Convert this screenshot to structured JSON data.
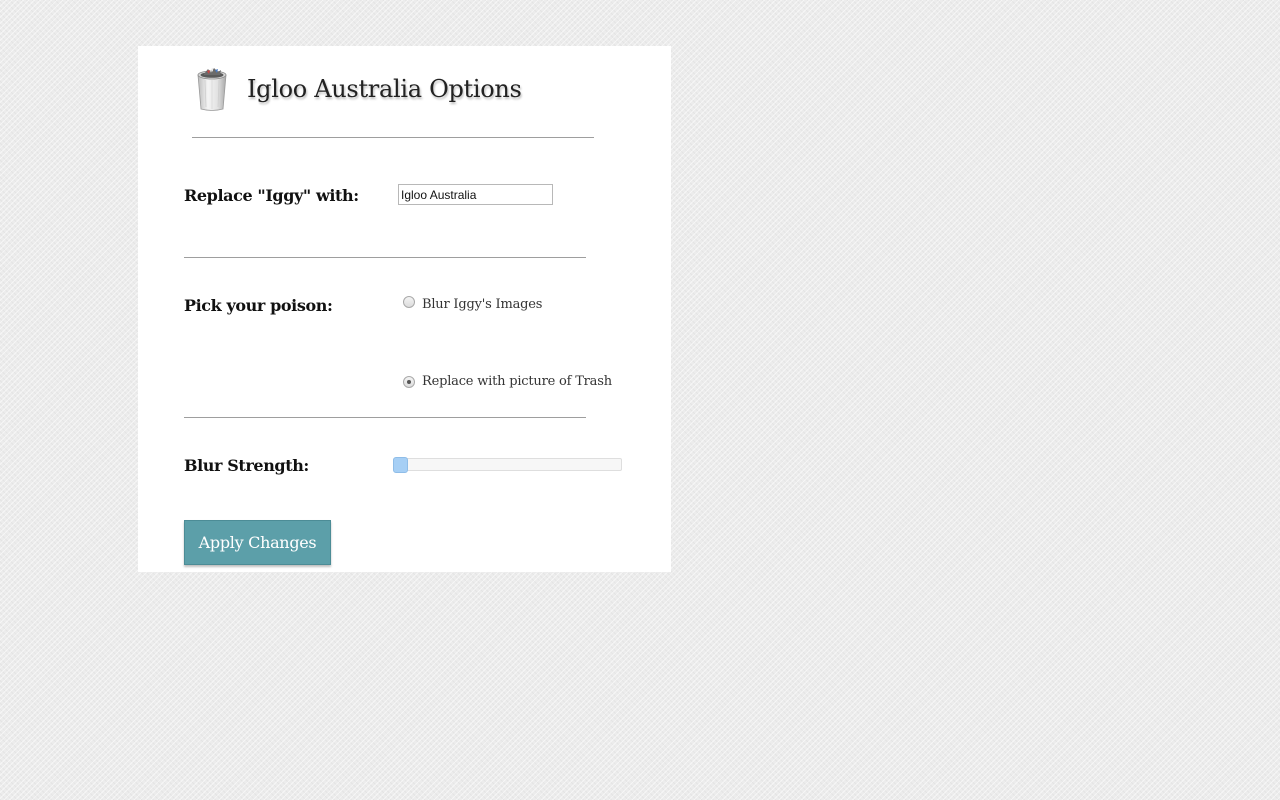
{
  "header": {
    "title": "Igloo Australia Options",
    "icon": "trash-can-icon"
  },
  "replace": {
    "label": "Replace \"Iggy\" with:",
    "value": "Igloo Australia"
  },
  "poison": {
    "label": "Pick your poison:",
    "options": [
      {
        "label": "Blur Iggy's Images",
        "checked": false
      },
      {
        "label": "Replace with picture of Trash",
        "checked": true
      }
    ]
  },
  "blur": {
    "label": "Blur Strength:",
    "value_fraction": 0
  },
  "apply": {
    "label": "Apply Changes"
  },
  "colors": {
    "button": "#5c9fa9",
    "slider_thumb": "#a6cff5",
    "background": "#ececec",
    "panel": "#ffffff"
  }
}
